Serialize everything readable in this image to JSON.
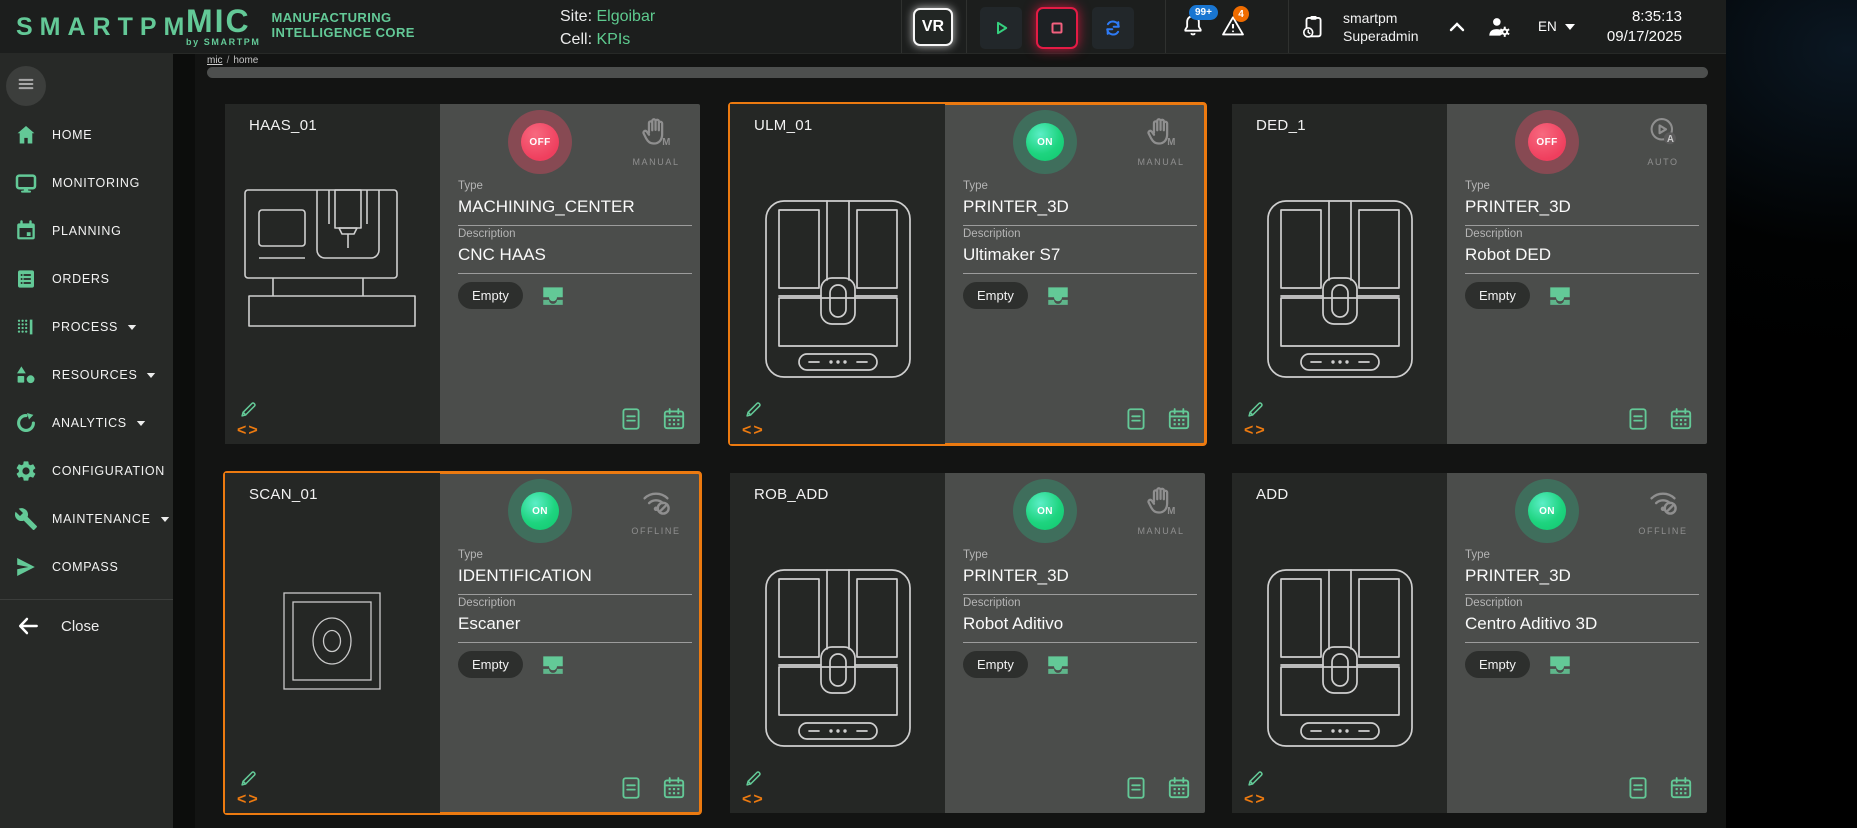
{
  "header": {
    "brand": "SMARTPM",
    "logo": {
      "mic": "MIC",
      "by": "by SMARTPM",
      "line1": "MANUFACTURING",
      "line2": "INTELLIGENCE CORE"
    },
    "breadcrumb": {
      "root": "mic",
      "sep": "/",
      "current": "home"
    },
    "site_label": "Site:",
    "site_value": "Elgoibar",
    "cell_label": "Cell:",
    "cell_value": "KPIs",
    "vr_label": "VR",
    "notifications": {
      "bell_badge": "99+",
      "alert_badge": "4"
    },
    "user": {
      "org": "smartpm",
      "role": "Superadmin"
    },
    "language": "EN",
    "clock": {
      "time": "8:35:13",
      "date": "09/17/2025"
    }
  },
  "sidebar": {
    "items": [
      {
        "label": "HOME",
        "icon": "home",
        "expandable": false
      },
      {
        "label": "MONITORING",
        "icon": "monitor",
        "expandable": false
      },
      {
        "label": "PLANNING",
        "icon": "calendar",
        "expandable": false
      },
      {
        "label": "ORDERS",
        "icon": "orders",
        "expandable": false
      },
      {
        "label": "PROCESS",
        "icon": "process",
        "expandable": true
      },
      {
        "label": "RESOURCES",
        "icon": "resources",
        "expandable": true
      },
      {
        "label": "ANALYTICS",
        "icon": "analytics",
        "expandable": true
      },
      {
        "label": "CONFIGURATION",
        "icon": "gear",
        "expandable": true
      },
      {
        "label": "MAINTENANCE",
        "icon": "wrench",
        "expandable": true
      },
      {
        "label": "COMPASS",
        "icon": "compass",
        "expandable": false
      }
    ],
    "close_label": "Close"
  },
  "labels": {
    "type": "Type",
    "description": "Description",
    "code_icon": "<>"
  },
  "cards": [
    {
      "id": "HAAS_01",
      "machine": "cnc",
      "status": "OFF",
      "mode": "MANUAL",
      "type": "MACHINING_CENTER",
      "description": "CNC HAAS",
      "slot": "Empty",
      "selected": false
    },
    {
      "id": "ULM_01",
      "machine": "printer",
      "status": "ON",
      "mode": "MANUAL",
      "type": "PRINTER_3D",
      "description": "Ultimaker S7",
      "slot": "Empty",
      "selected": true
    },
    {
      "id": "DED_1",
      "machine": "printer",
      "status": "OFF",
      "mode": "AUTO",
      "type": "PRINTER_3D",
      "description": "Robot DED",
      "slot": "Empty",
      "selected": false
    },
    {
      "id": "SCAN_01",
      "machine": "scanner",
      "status": "ON",
      "mode": "OFFLINE",
      "type": "IDENTIFICATION",
      "description": "Escaner",
      "slot": "Empty",
      "selected": true
    },
    {
      "id": "ROB_ADD",
      "machine": "printer",
      "status": "ON",
      "mode": "MANUAL",
      "type": "PRINTER_3D",
      "description": "Robot Aditivo",
      "slot": "Empty",
      "selected": false
    },
    {
      "id": "ADD",
      "machine": "printer",
      "status": "ON",
      "mode": "OFFLINE",
      "type": "PRINTER_3D",
      "description": "Centro Aditivo 3D",
      "slot": "Empty",
      "selected": false
    }
  ],
  "colors": {
    "accent_green": "#63c997",
    "accent_orange": "#ec7a10",
    "status_on": "#1ed47f",
    "status_off": "#f0435f",
    "badge_blue": "#1976d2",
    "badge_orange": "#ef6c00",
    "stop_red": "#e51b45",
    "refresh_blue": "#2e7bf6"
  }
}
